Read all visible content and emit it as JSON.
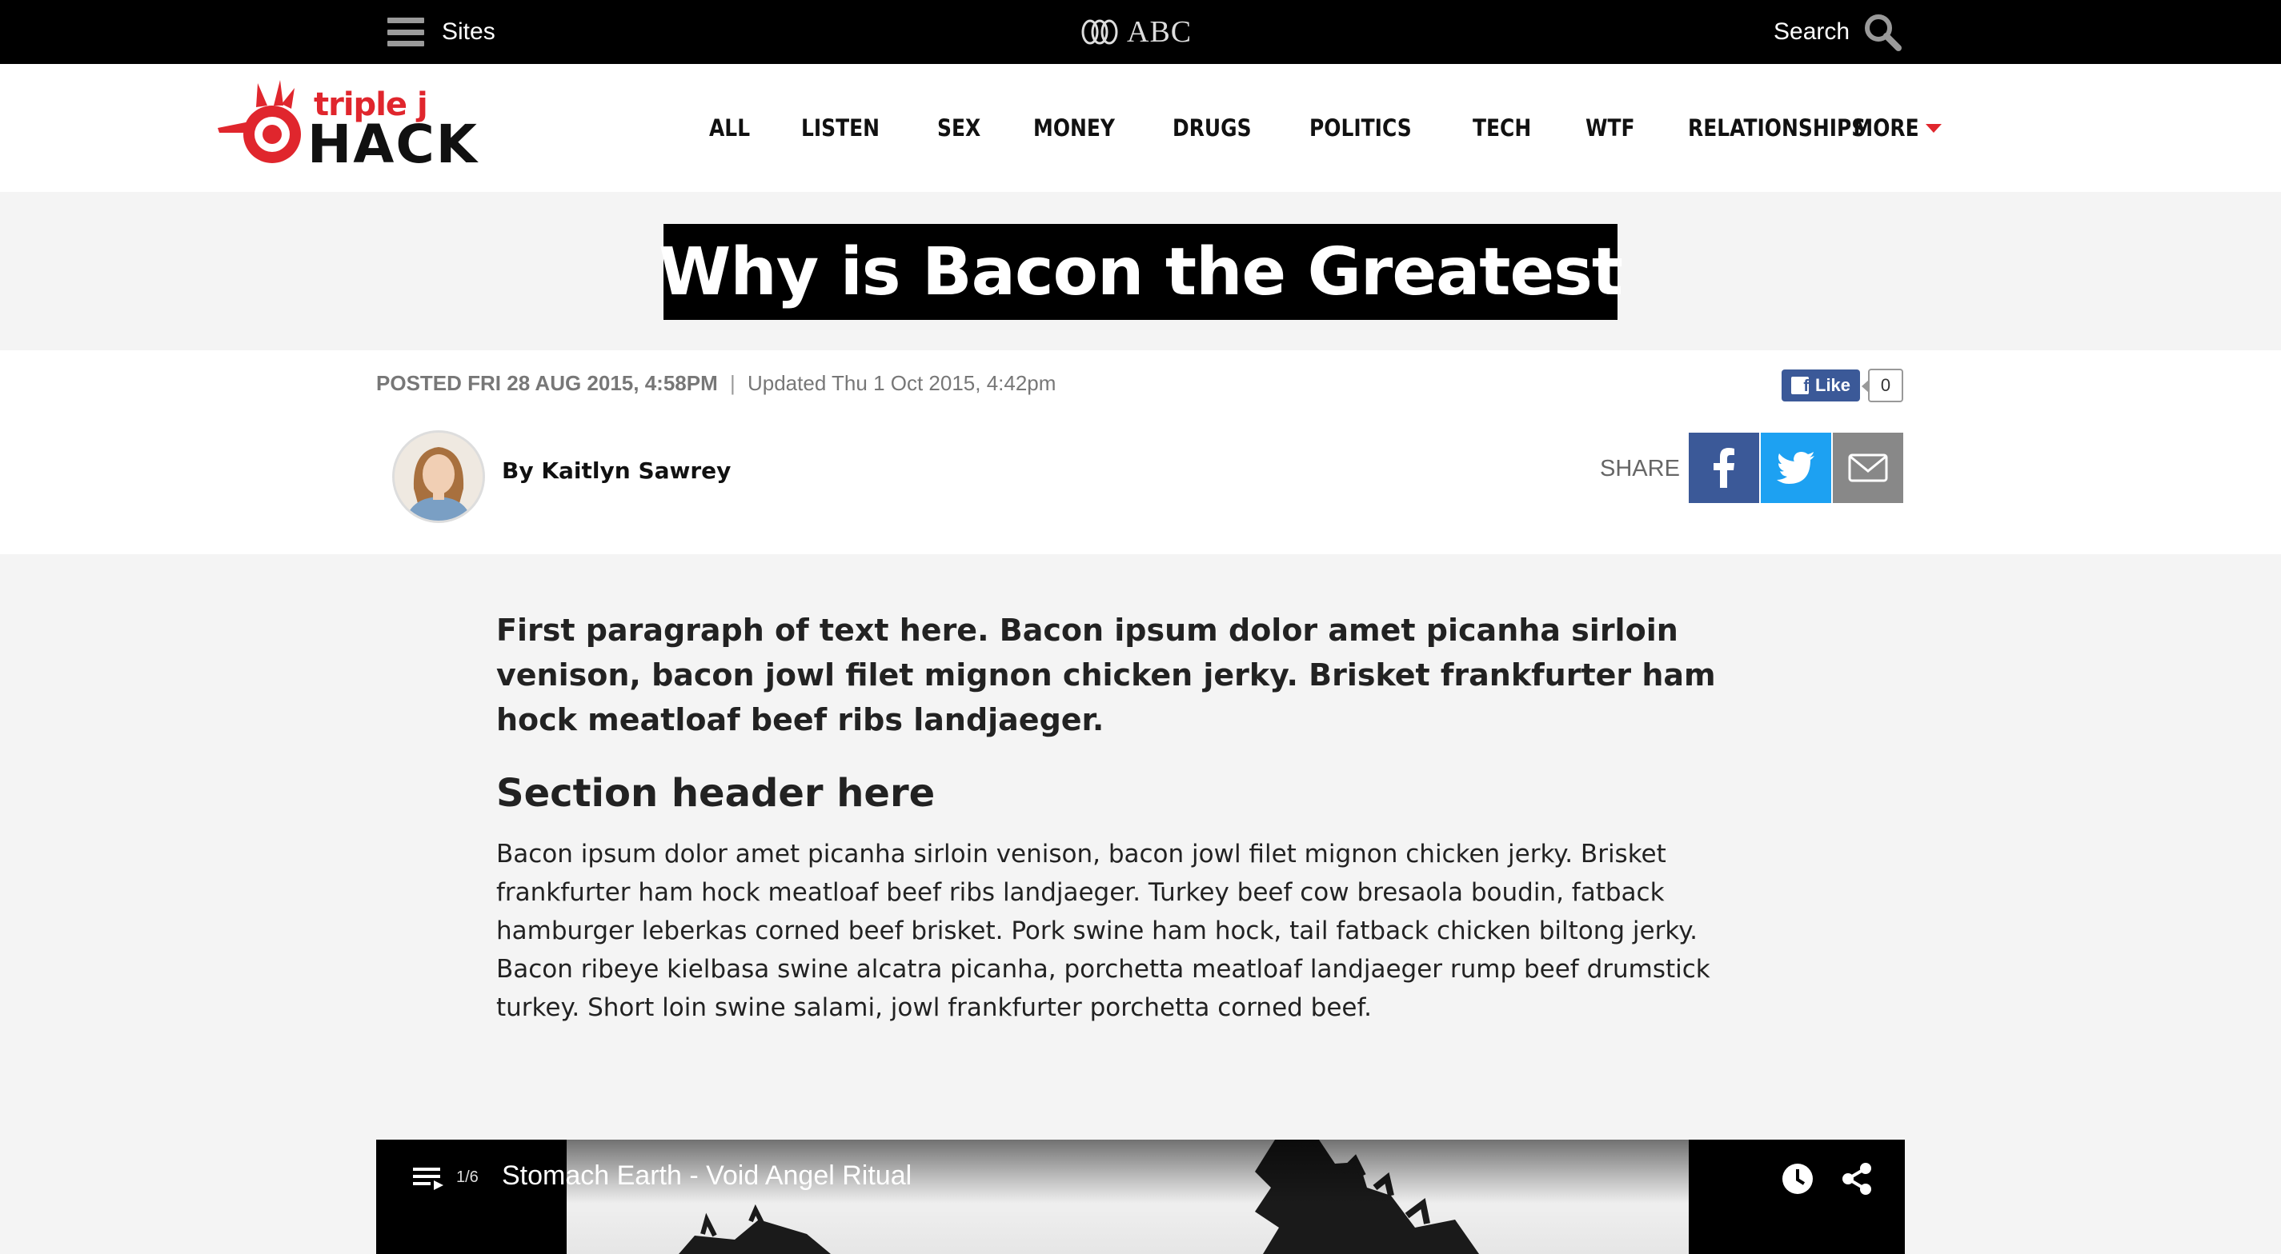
{
  "topbar": {
    "sites_label": "Sites",
    "abc_label": "ABC",
    "search_label": "Search"
  },
  "header": {
    "logo_top": "triple j",
    "logo_main": "HACK",
    "nav": [
      "ALL",
      "LISTEN",
      "SEX",
      "MONEY",
      "DRUGS",
      "POLITICS",
      "TECH",
      "WTF",
      "RELATIONSHIPS"
    ],
    "more_label": "MORE"
  },
  "article": {
    "title": "Why is Bacon the Greatest",
    "posted": "POSTED FRI 28 AUG 2015, 4:58PM",
    "separator": "|",
    "updated": "Updated Thu 1 Oct 2015, 4:42pm",
    "fb_like_label": "Like",
    "fb_like_count": "0",
    "author": "By Kaitlyn Sawrey",
    "share_label": "SHARE",
    "lead": "First paragraph of text here. Bacon ipsum dolor amet picanha sirloin venison, bacon jowl filet mignon chicken jerky. Brisket frankfurter ham hock meatloaf beef ribs landjaeger.",
    "section_header": "Section header here",
    "body": "Bacon ipsum dolor amet picanha sirloin venison, bacon jowl filet mignon chicken jerky. Brisket frankfurter ham hock meatloaf beef ribs landjaeger. Turkey beef cow bresaola boudin, fatback hamburger leberkas corned beef brisket. Pork swine ham hock, tail fatback chicken biltong jerky. Bacon ribeye kielbasa swine alcatra picanha, porchetta meatloaf landjaeger rump beef drumstick turkey. Short loin swine salami, jowl frankfurter porchetta corned beef."
  },
  "video": {
    "index": "1/6",
    "title": "Stomach Earth - Void Angel Ritual"
  },
  "icons": {
    "sites": "hamburger-menu-icon",
    "abc": "abc-lissajous-logo-icon",
    "search": "magnifier-icon",
    "more": "caret-down-icon",
    "share_facebook": "facebook-icon",
    "share_twitter": "twitter-icon",
    "share_email": "email-icon",
    "playlist": "playlist-icon",
    "watch_later": "clock-icon",
    "video_share": "share-icon"
  },
  "colors": {
    "brand_red": "#e0262d",
    "facebook": "#3b5998",
    "twitter": "#1da1f2",
    "email": "#888888"
  }
}
